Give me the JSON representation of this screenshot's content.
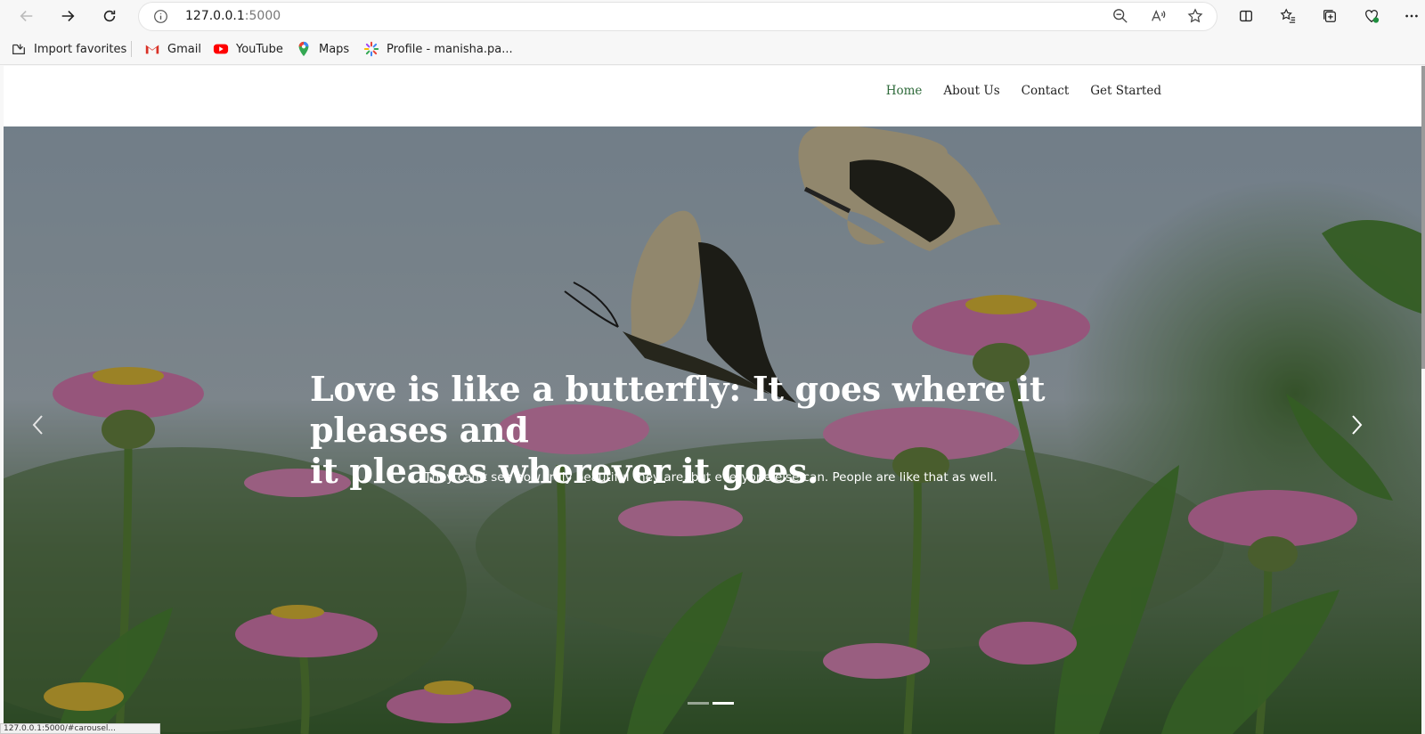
{
  "browser": {
    "url_host": "127.0.0.1",
    "url_port": ":5000",
    "status_text": "127.0.0.1:5000/#carousel..."
  },
  "bookmarks": [
    {
      "label": "Import favorites",
      "icon": "import-icon"
    },
    {
      "label": "Gmail",
      "icon": "gmail-icon"
    },
    {
      "label": "YouTube",
      "icon": "youtube-icon"
    },
    {
      "label": "Maps",
      "icon": "maps-icon"
    },
    {
      "label": "Profile - manisha.pa...",
      "icon": "profile-icon"
    }
  ],
  "nav": {
    "items": [
      {
        "label": "Home",
        "active": true
      },
      {
        "label": "About Us",
        "active": false
      },
      {
        "label": "Contact",
        "active": false
      },
      {
        "label": "Get Started",
        "active": false
      }
    ],
    "active_color": "#2e6a3a"
  },
  "hero": {
    "title_line1": "Love is like a butterfly: It goes where it pleases and",
    "title_line2": "it pleases wherever it goes.",
    "subtitle": "They can't see how truly beautiful they are, but everyone else can. People are like that as well.",
    "prev_icon": "chevron-left-icon",
    "next_icon": "chevron-right-icon",
    "slides": 2,
    "active_slide": 2
  }
}
